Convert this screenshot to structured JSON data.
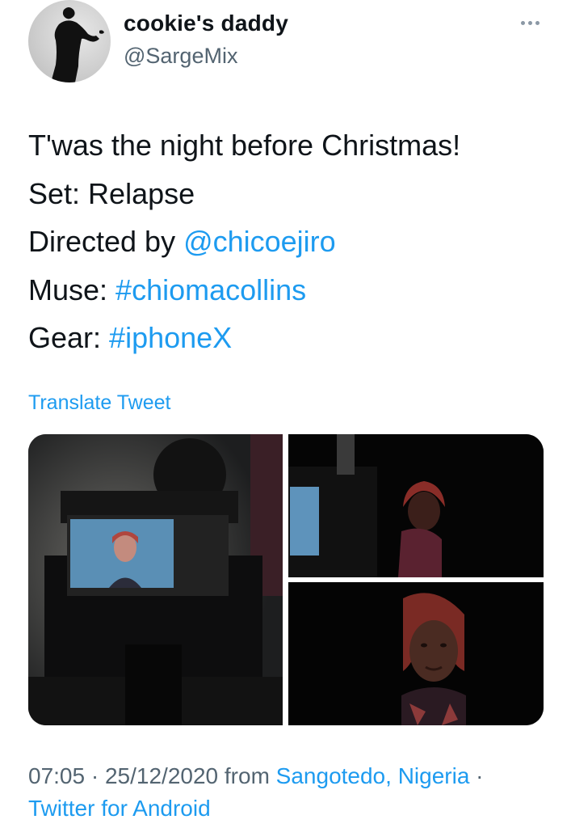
{
  "user": {
    "display_name": "cookie's daddy",
    "handle": "@SargeMix"
  },
  "tweet": {
    "lines": [
      {
        "text": "T'was the night before Christmas!"
      },
      {
        "prefix": "Set: ",
        "text": "Relapse"
      },
      {
        "prefix": "Directed by ",
        "link": "@chicoejiro"
      },
      {
        "prefix": "Muse: ",
        "link": "#chiomacollins"
      },
      {
        "prefix": "Gear: ",
        "link": "#iphoneX"
      }
    ],
    "translate_label": "Translate Tweet"
  },
  "meta": {
    "time": "07:05",
    "sep1": " · ",
    "date": "25/12/2020",
    "from_label": " from ",
    "location": "Sangotedo, Nigeria",
    "sep2": " ·",
    "source": "Twitter for Android"
  },
  "colors": {
    "link": "#1d9bf0",
    "secondary_text": "#536471",
    "primary_text": "#0f1419"
  }
}
